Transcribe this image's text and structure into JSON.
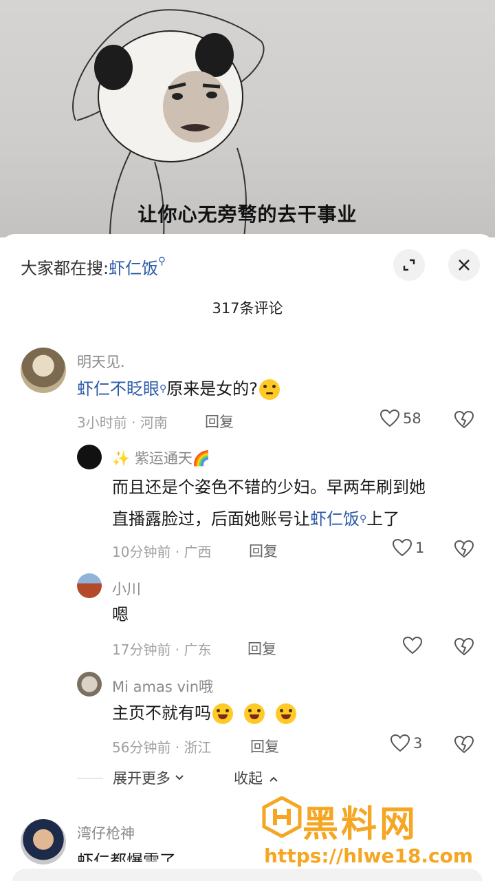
{
  "video": {
    "subtitle": "让你心无旁骛的去干事业"
  },
  "sheet": {
    "search_prefix": "大家都在搜:",
    "search_keyword": "虾仁饭",
    "comment_count": "317条评论"
  },
  "comments": [
    {
      "user": "明天见.",
      "link": "虾仁不眨眼",
      "text": "原来是女的?",
      "meta": "3小时前 · 河南",
      "reply": "回复",
      "likes": "58",
      "replies": [
        {
          "user": "✨ 紫运通天🌈",
          "line1": "而且还是个姿色不错的少妇。早两年刷到她",
          "line2_pre": "直播露脸过，后面她账号让",
          "line2_link": "虾仁饭",
          "line2_post": "上了",
          "meta": "10分钟前 · 广西",
          "reply": "回复",
          "likes": "1"
        },
        {
          "user": "小川",
          "text": "嗯",
          "meta": "17分钟前 · 广东",
          "reply": "回复",
          "likes": ""
        },
        {
          "user": "Mi amas vin哦",
          "text": "主页不就有吗",
          "meta": "56分钟前 · 浙江",
          "reply": "回复",
          "likes": "3"
        }
      ],
      "expand": "展开更多",
      "collapse": "收起"
    },
    {
      "user": "湾仔枪神",
      "text": "虾仁都爆雷了"
    }
  ],
  "watermark": {
    "title": "黑料网",
    "url": "https://hlwe18.com"
  },
  "colors": {
    "link": "#2b5aa8",
    "watermark": "#f5a623"
  }
}
